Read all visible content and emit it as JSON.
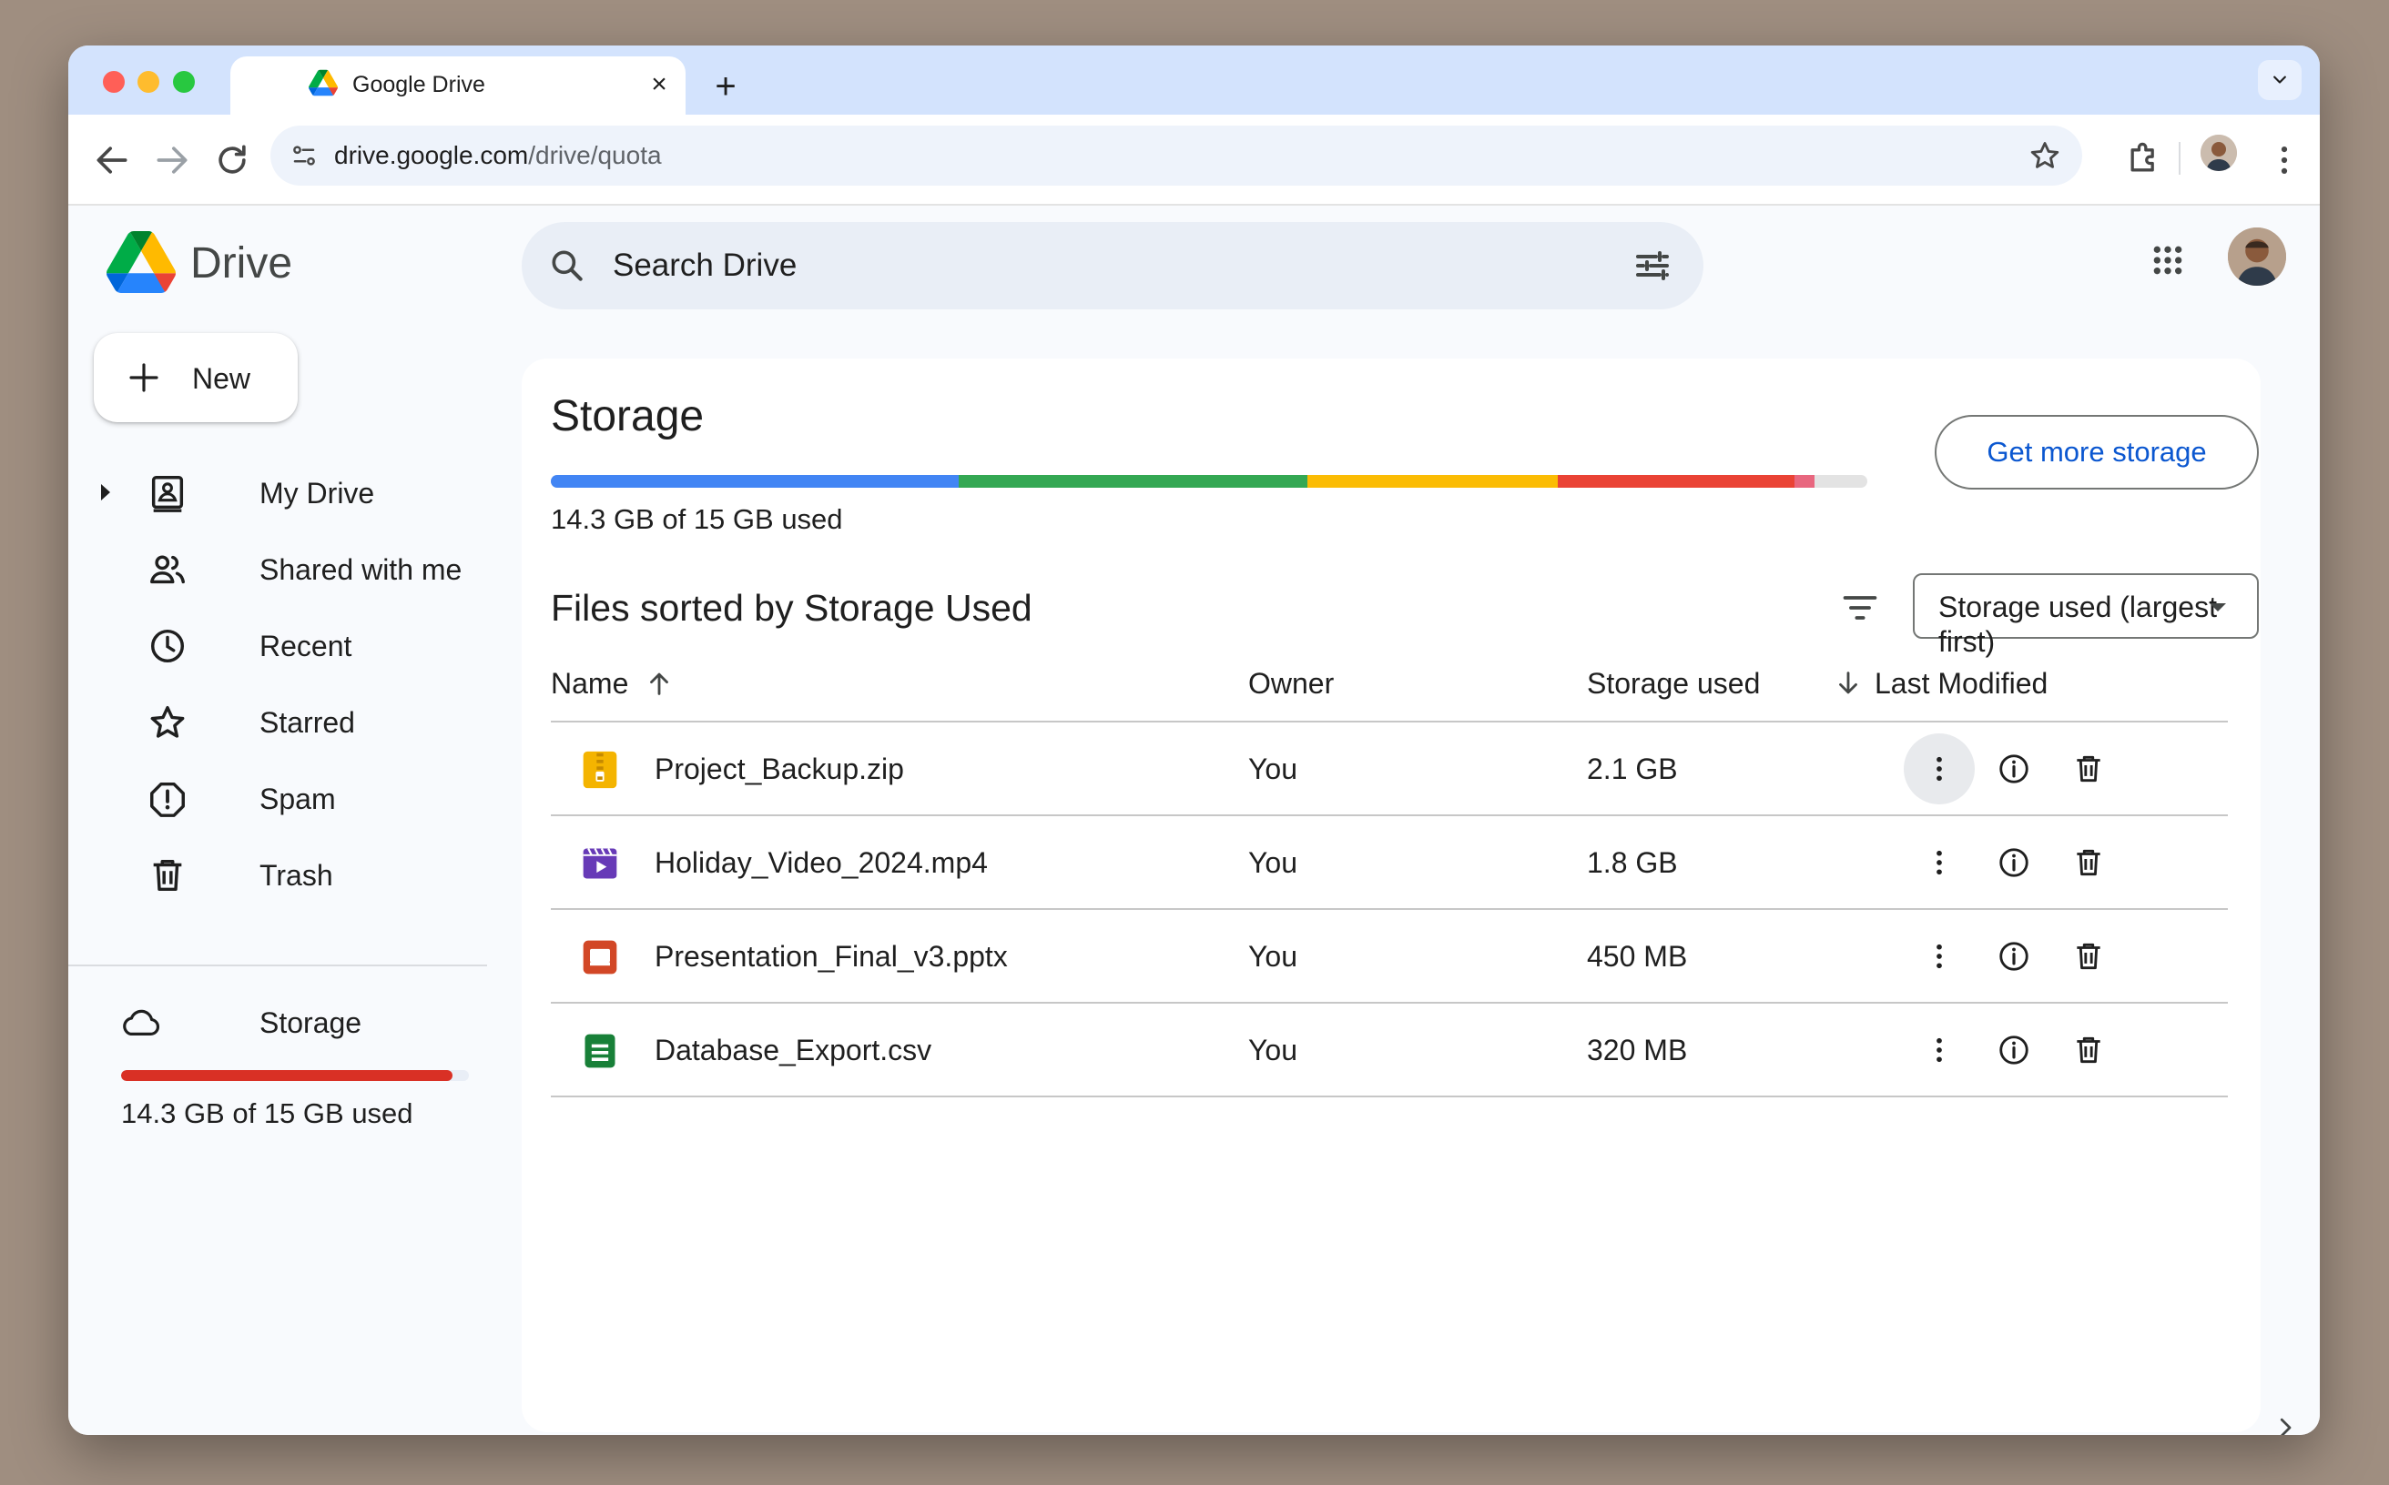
{
  "browser": {
    "tab_title": "Google Drive",
    "tab_close": "×",
    "new_tab": "+",
    "url_host": "drive.google.com",
    "url_path": "/drive/quota"
  },
  "app": {
    "logo_text": "Drive",
    "search_placeholder": "Search Drive"
  },
  "sidebar": {
    "new_label": "New",
    "items": [
      {
        "label": "My Drive",
        "icon": "my-drive-icon"
      },
      {
        "label": "Shared with me",
        "icon": "shared-icon"
      },
      {
        "label": "Recent",
        "icon": "clock-icon"
      },
      {
        "label": "Starred",
        "icon": "star-icon"
      },
      {
        "label": "Spam",
        "icon": "spam-icon"
      },
      {
        "label": "Trash",
        "icon": "trash-icon"
      },
      {
        "label": "Storage",
        "icon": "cloud-icon"
      }
    ],
    "storage_text": "14.3 GB of 15 GB used",
    "storage_fraction": 0.953
  },
  "main": {
    "title": "Storage",
    "get_more_label": "Get more storage",
    "quota_text": "14.3 GB of 15 GB used",
    "quota_segments": [
      {
        "color": "#4285f4",
        "fraction": 0.31
      },
      {
        "color": "#34a853",
        "fraction": 0.265
      },
      {
        "color": "#fbbc04",
        "fraction": 0.19
      },
      {
        "color": "#ea4335",
        "fraction": 0.18
      },
      {
        "color": "#e8677f",
        "fraction": 0.015
      }
    ],
    "section_title": "Files sorted by Storage Used",
    "sort_label": "Storage used (largest first)",
    "columns": {
      "name": "Name",
      "owner": "Owner",
      "storage": "Storage used",
      "modified": "Last Modified"
    },
    "files": [
      {
        "name": "Project_Backup.zip",
        "owner": "You",
        "size": "2.1 GB",
        "icon": "zip-file-icon",
        "color": "#f4b400"
      },
      {
        "name": "Holiday_Video_2024.mp4",
        "owner": "You",
        "size": "1.8 GB",
        "icon": "video-file-icon",
        "color": "#673ab7"
      },
      {
        "name": "Presentation_Final_v3.pptx",
        "owner": "You",
        "size": "450 MB",
        "icon": "slides-file-icon",
        "color": "#d24726"
      },
      {
        "name": "Database_Export.csv",
        "owner": "You",
        "size": "320 MB",
        "icon": "sheets-file-icon",
        "color": "#188038"
      }
    ]
  }
}
